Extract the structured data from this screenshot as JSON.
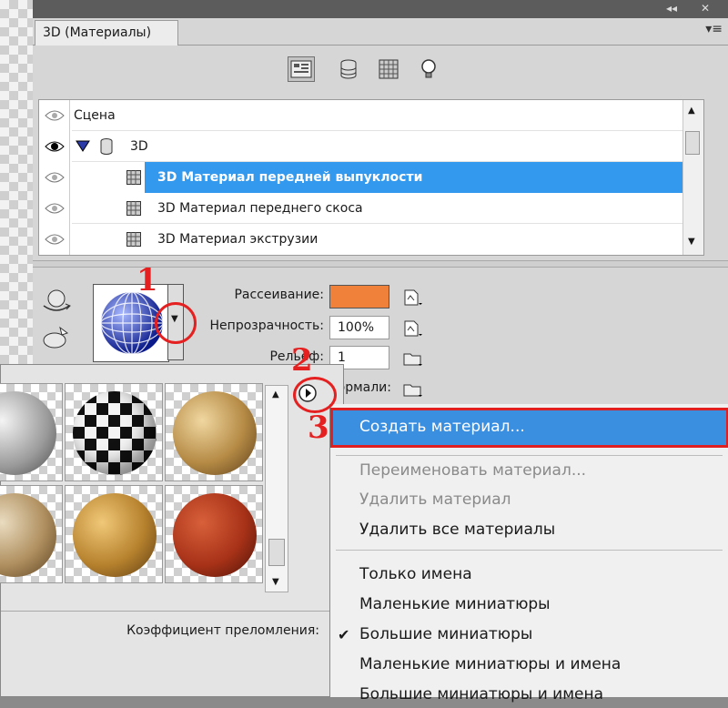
{
  "panel": {
    "tab_title": "3D (Материалы)",
    "window_controls": [
      "◂◂",
      "✕"
    ],
    "panel_menu_glyph": "▾≡",
    "toolbar_icons": [
      "scene-filter-icon",
      "mesh-filter-icon",
      "material-filter-icon",
      "light-filter-icon"
    ]
  },
  "scene_list": {
    "header": "Сцена",
    "items": [
      {
        "label": "3D",
        "selected": false
      },
      {
        "label": "3D Материал передней выпуклости",
        "selected": true
      },
      {
        "label": "3D Материал переднего скоса",
        "selected": false
      },
      {
        "label": "3D Материал экструзии",
        "selected": false
      }
    ]
  },
  "properties": {
    "diffuse_label": "Рассеивание:",
    "diffuse_color": "#f0813b",
    "opacity_label": "Непрозрачность:",
    "opacity_value": "100%",
    "bump_label": "Рельеф:",
    "bump_value": "1",
    "normal_label": "Нормали:",
    "refraction_label": "Коэффициент преломления:"
  },
  "material_thumbnails": [
    {
      "name": "gray-marble-material"
    },
    {
      "name": "checker-material"
    },
    {
      "name": "bronze-wrinkled-material"
    },
    {
      "name": "wood-material"
    },
    {
      "name": "cork-material"
    },
    {
      "name": "red-rubber-material"
    }
  ],
  "context_menu": {
    "items": [
      {
        "label": "Создать материал...",
        "state": "highlighted"
      },
      {
        "label": "Переименовать материал...",
        "state": "disabled"
      },
      {
        "label": "Удалить материал",
        "state": "disabled"
      },
      {
        "label": "Удалить все материалы",
        "state": "normal"
      },
      {
        "label": "Только имена",
        "state": "normal"
      },
      {
        "label": "Маленькие миниатюры",
        "state": "normal"
      },
      {
        "label": "Большие миниатюры",
        "state": "checked"
      },
      {
        "label": "Маленькие миниатюры и имена",
        "state": "normal"
      },
      {
        "label": "Большие миниатюры и имена",
        "state": "normal"
      }
    ],
    "check_glyph": "✔"
  },
  "annotations": {
    "step1": "1",
    "step2": "2",
    "step3": "3",
    "color": "#e52020"
  }
}
